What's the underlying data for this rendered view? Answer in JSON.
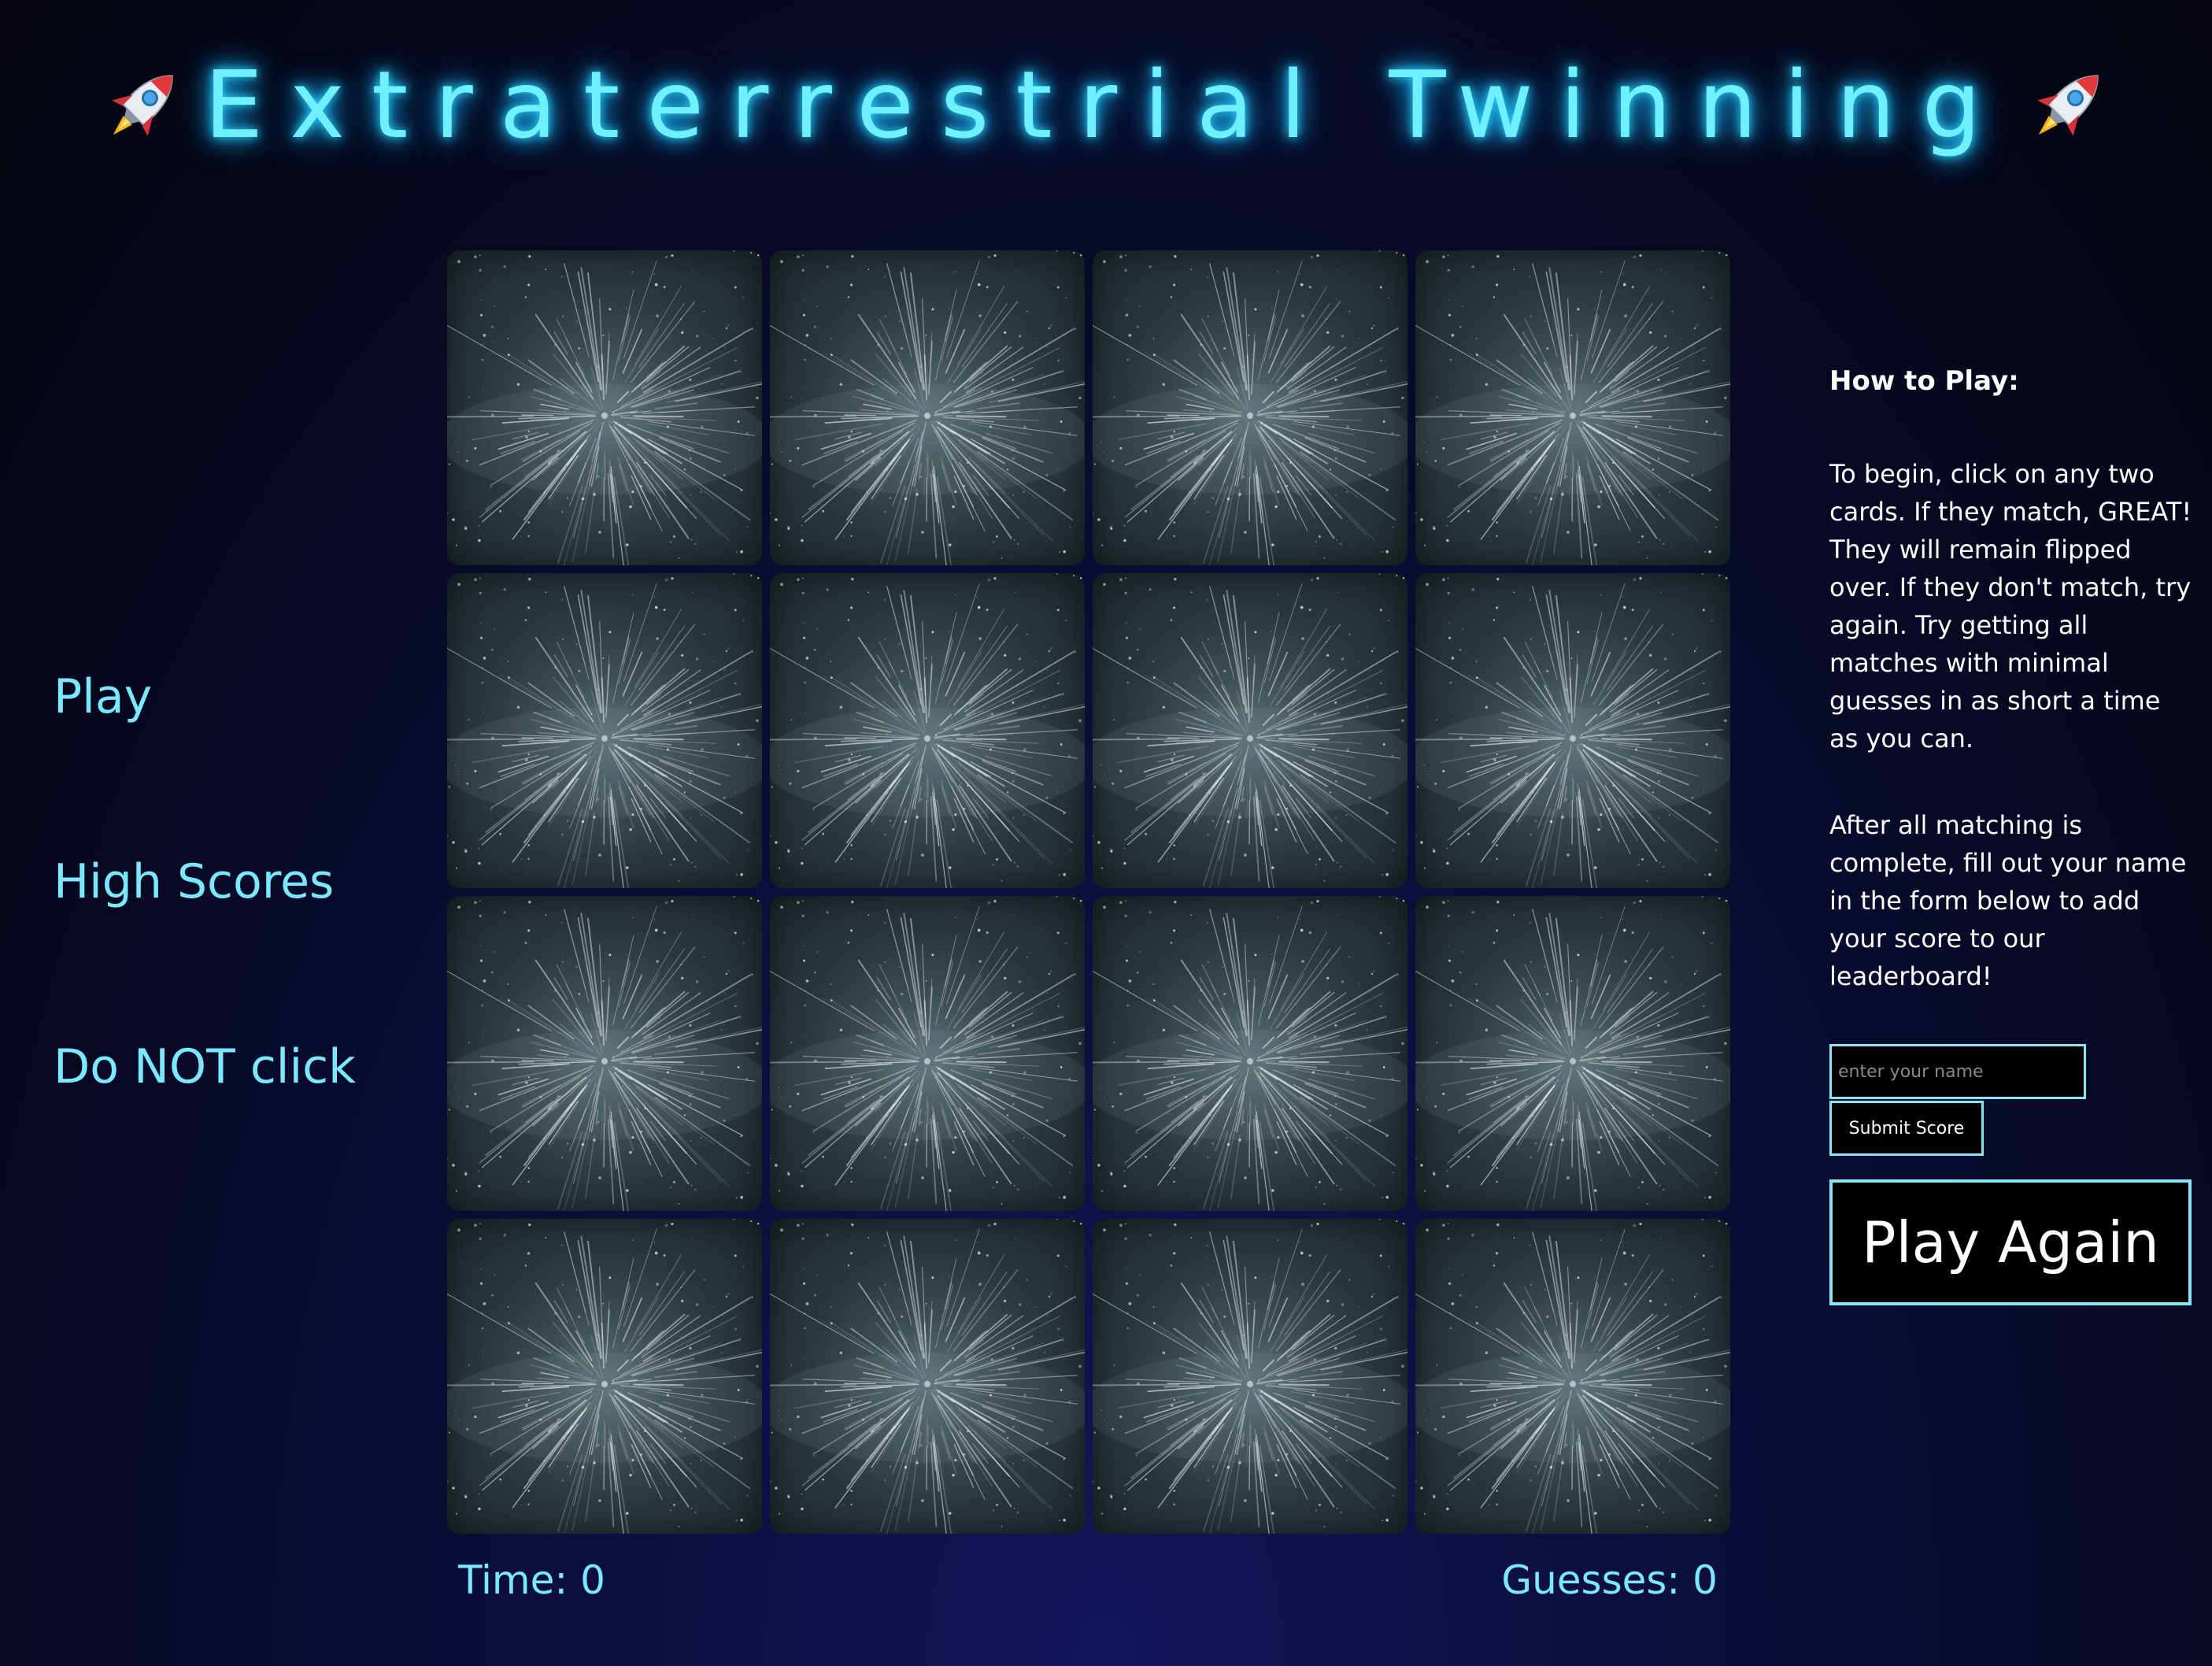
{
  "header": {
    "title": "Extraterrestrial Twinning",
    "left_icon": "rocket-icon",
    "right_icon": "rocket-icon"
  },
  "nav": {
    "items": [
      {
        "label": "Play"
      },
      {
        "label": "High Scores"
      },
      {
        "label": "Do NOT click"
      }
    ]
  },
  "board": {
    "rows": 4,
    "columns": 4,
    "card_back": "starfield-warp-image",
    "cards_face_down": 16
  },
  "stats": {
    "time_label": "Time: 0",
    "guesses_label": "Guesses: 0"
  },
  "instructions": {
    "title": "How to Play:",
    "paragraph1": "To begin, click on any two cards. If they match, GREAT! They will remain flipped over. If they don't match, try again. Try getting all matches with minimal guesses in as short a time as you can.",
    "paragraph2": "After all matching is complete, fill out your name in the form below to add your score to our leaderboard!"
  },
  "form": {
    "name_placeholder": "enter your name",
    "name_value": "",
    "submit_label": "Submit Score"
  },
  "play_again_label": "Play Again",
  "colors": {
    "title_glow": "#6ef0ff",
    "nav_text": "#7ae8ff",
    "button_border": "#8ae6f2",
    "background_top": "#04050f",
    "background_bottom": "#13155a"
  }
}
